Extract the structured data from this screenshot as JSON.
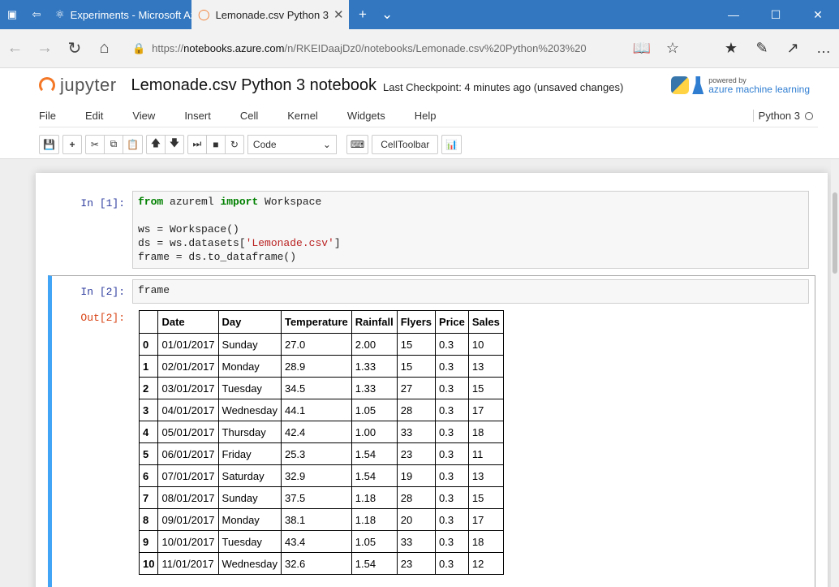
{
  "browser": {
    "tabs": [
      {
        "label": "Experiments - Microsoft Azu",
        "active": false
      },
      {
        "label": "Lemonade.csv Python 3",
        "active": true
      }
    ],
    "url_prefix": "https://",
    "url_host": "notebooks.azure.com",
    "url_path": "/n/RKEIDaajDz0/notebooks/Lemonade.csv%20Python%203%20"
  },
  "jupyter": {
    "logo_text": "jupyter",
    "notebook_title": "Lemonade.csv Python 3 notebook",
    "checkpoint": "Last Checkpoint: 4 minutes ago (unsaved changes)",
    "powered_by": "powered by",
    "azure_ml": "azure machine learning",
    "kernel": "Python 3"
  },
  "menu": [
    "File",
    "Edit",
    "View",
    "Insert",
    "Cell",
    "Kernel",
    "Widgets",
    "Help"
  ],
  "toolbar": {
    "cell_type": "Code",
    "celltoolbar_label": "CellToolbar"
  },
  "cells": {
    "cell1": {
      "prompt": "In [1]:",
      "line1_kw1": "from",
      "line1_mod": " azureml ",
      "line1_kw2": "import",
      "line1_rest": " Workspace",
      "line3": "ws = Workspace()",
      "line4_a": "ds = ws.datasets[",
      "line4_str": "'Lemonade.csv'",
      "line4_b": "]",
      "line5": "frame = ds.to_dataframe()"
    },
    "cell2": {
      "prompt": "In [2]:",
      "code": "frame",
      "out_prompt": "Out[2]:"
    }
  },
  "dataframe": {
    "columns": [
      "",
      "Date",
      "Day",
      "Temperature",
      "Rainfall",
      "Flyers",
      "Price",
      "Sales"
    ],
    "rows": [
      [
        "0",
        "01/01/2017",
        "Sunday",
        "27.0",
        "2.00",
        "15",
        "0.3",
        "10"
      ],
      [
        "1",
        "02/01/2017",
        "Monday",
        "28.9",
        "1.33",
        "15",
        "0.3",
        "13"
      ],
      [
        "2",
        "03/01/2017",
        "Tuesday",
        "34.5",
        "1.33",
        "27",
        "0.3",
        "15"
      ],
      [
        "3",
        "04/01/2017",
        "Wednesday",
        "44.1",
        "1.05",
        "28",
        "0.3",
        "17"
      ],
      [
        "4",
        "05/01/2017",
        "Thursday",
        "42.4",
        "1.00",
        "33",
        "0.3",
        "18"
      ],
      [
        "5",
        "06/01/2017",
        "Friday",
        "25.3",
        "1.54",
        "23",
        "0.3",
        "11"
      ],
      [
        "6",
        "07/01/2017",
        "Saturday",
        "32.9",
        "1.54",
        "19",
        "0.3",
        "13"
      ],
      [
        "7",
        "08/01/2017",
        "Sunday",
        "37.5",
        "1.18",
        "28",
        "0.3",
        "15"
      ],
      [
        "8",
        "09/01/2017",
        "Monday",
        "38.1",
        "1.18",
        "20",
        "0.3",
        "17"
      ],
      [
        "9",
        "10/01/2017",
        "Tuesday",
        "43.4",
        "1.05",
        "33",
        "0.3",
        "18"
      ],
      [
        "10",
        "11/01/2017",
        "Wednesday",
        "32.6",
        "1.54",
        "23",
        "0.3",
        "12"
      ]
    ]
  }
}
